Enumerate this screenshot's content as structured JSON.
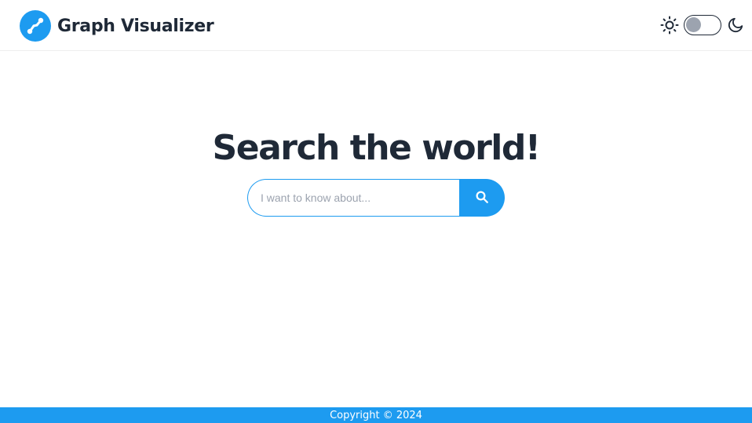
{
  "header": {
    "app_title": "Graph Visualizer",
    "logo_icon": "graph-node-icon",
    "theme": {
      "light_icon": "sun-icon",
      "dark_icon": "moon-icon",
      "dark_mode_enabled": false
    }
  },
  "hero": {
    "heading": "Search the world!"
  },
  "search": {
    "placeholder": "I want to know about...",
    "value": "",
    "button_icon": "search-icon"
  },
  "footer": {
    "text": "Copyright © 2024"
  },
  "colors": {
    "accent": "#1d9bf0",
    "text": "#1f2937",
    "toggle_knob": "#9ca3af"
  }
}
